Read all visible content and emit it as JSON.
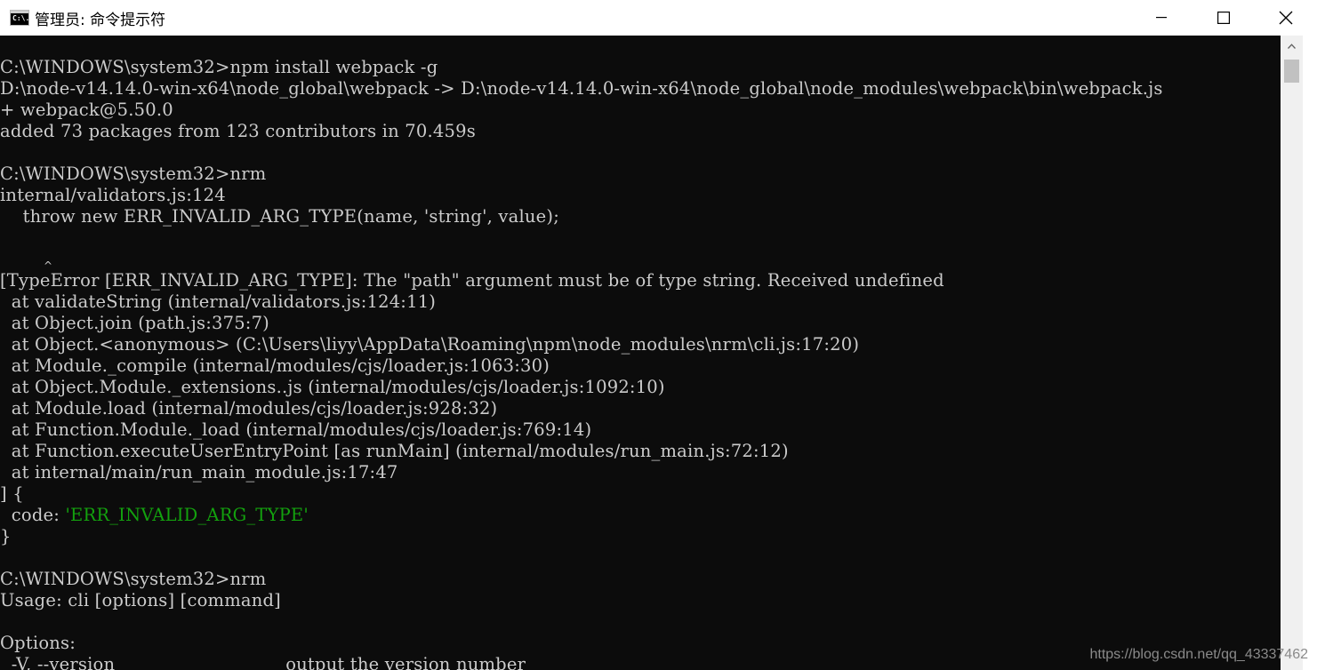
{
  "window": {
    "title": "管理员: 命令提示符",
    "icon_glyph": "C:\\."
  },
  "console": {
    "lines": [
      {
        "text": "C:\\WINDOWS\\system32>npm install webpack -g"
      },
      {
        "text": "D:\\node-v14.14.0-win-x64\\node_global\\webpack -> D:\\node-v14.14.0-win-x64\\node_global\\node_modules\\webpack\\bin\\webpack.js"
      },
      {
        "text": "+ webpack@5.50.0"
      },
      {
        "text": "added 73 packages from 123 contributors in 70.459s"
      },
      {
        "text": ""
      },
      {
        "text": "C:\\WINDOWS\\system32>nrm"
      },
      {
        "text": "internal/validators.js:124"
      },
      {
        "text": "    throw new ERR_INVALID_ARG_TYPE(name, 'string', value);"
      },
      {
        "text": ""
      },
      {
        "text": ""
      },
      {
        "text": "[TypeError [ERR_INVALID_ARG_TYPE]: The \"path\" argument must be of type string. Received undefined"
      },
      {
        "text": "  at validateString (internal/validators.js:124:11)"
      },
      {
        "text": "  at Object.join (path.js:375:7)"
      },
      {
        "text": "  at Object.<anonymous> (C:\\Users\\liyy\\AppData\\Roaming\\npm\\node_modules\\nrm\\cli.js:17:20)"
      },
      {
        "text": "  at Module._compile (internal/modules/cjs/loader.js:1063:30)"
      },
      {
        "text": "  at Object.Module._extensions..js (internal/modules/cjs/loader.js:1092:10)"
      },
      {
        "text": "  at Module.load (internal/modules/cjs/loader.js:928:32)"
      },
      {
        "text": "  at Function.Module._load (internal/modules/cjs/loader.js:769:14)"
      },
      {
        "text": "  at Function.executeUserEntryPoint [as runMain] (internal/modules/run_main.js:72:12)"
      },
      {
        "text": "  at internal/main/run_main_module.js:17:47"
      },
      {
        "text": "] {"
      },
      {
        "prefix": "  code: ",
        "highlight": "'ERR_INVALID_ARG_TYPE'"
      },
      {
        "text": "}"
      },
      {
        "text": ""
      },
      {
        "text": "C:\\WINDOWS\\system32>nrm"
      },
      {
        "text": "Usage: cli [options] [command]"
      },
      {
        "text": ""
      },
      {
        "text": "Options:"
      },
      {
        "text": "  -V, --version                              output the version number"
      }
    ],
    "caret": "^",
    "text_color": "#cccccc",
    "highlight_color": "#13a10e",
    "background": "#0c0c0c"
  },
  "watermark": "https://blog.csdn.net/qq_43337462"
}
